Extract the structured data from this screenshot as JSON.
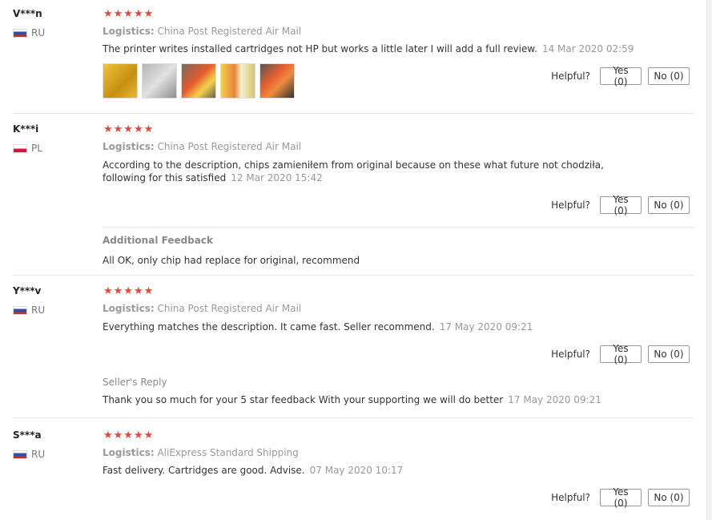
{
  "helpful_label": "Helpful?",
  "reviews": [
    {
      "user": "V***n",
      "country": "RU",
      "logistics_label": "Logistics:",
      "logistics_value": "China Post Registered Air Mail",
      "text": "The printer writes installed cartridges not HP but works a little later I will add a full review.",
      "date": "14 Mar 2020 02:59",
      "stars": 5,
      "yes": "Yes (0)",
      "no": "No (0)",
      "thumb_colors": [
        "#e6b12a",
        "#c8c8c8",
        "#d94b25",
        "#e2d14d",
        "#e8713a"
      ]
    },
    {
      "user": "K***i",
      "country": "PL",
      "logistics_label": "Logistics:",
      "logistics_value": "China Post Registered Air Mail",
      "text": "According to the description, chips zamieniłem from original because on these what future not chodziła, following for this satisfied",
      "date": "12 Mar 2020 15:42",
      "stars": 5,
      "yes": "Yes (0)",
      "no": "No (0)",
      "extra_label": "Additional Feedback",
      "extra_text": "All OK, only chip had replace for original, recommend"
    },
    {
      "user": "Y***v",
      "country": "RU",
      "logistics_label": "Logistics:",
      "logistics_value": "China Post Registered Air Mail",
      "text": "Everything matches the description. It came fast. Seller recommend.",
      "date": "17 May 2020 09:21",
      "stars": 5,
      "yes": "Yes (0)",
      "no": "No (0)",
      "extra_label": "Seller's Reply",
      "extra_text": "Thank you so much for your 5 star feedback With your supporting we will do better",
      "extra_date": "17 May 2020 09:21"
    },
    {
      "user": "S***a",
      "country": "RU",
      "logistics_label": "Logistics:",
      "logistics_value": "AliExpress Standard Shipping",
      "text": "Fast delivery. Cartridges are good. Advise.",
      "date": "07 May 2020 10:17",
      "stars": 5,
      "yes": "Yes (0)",
      "no": "No (0)"
    }
  ]
}
